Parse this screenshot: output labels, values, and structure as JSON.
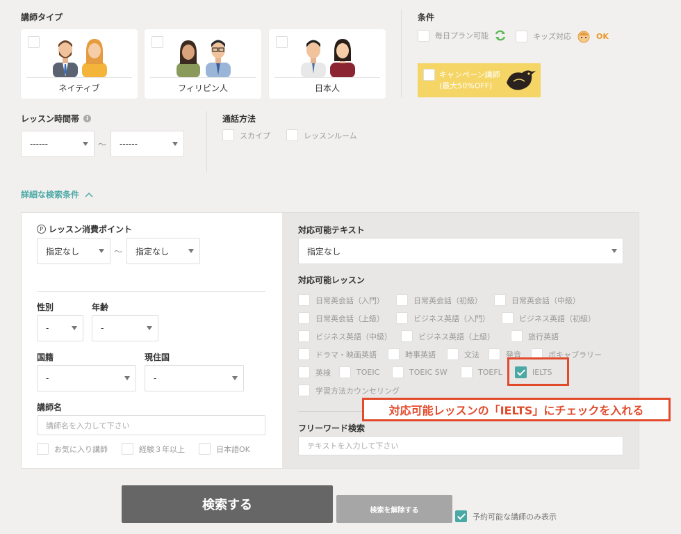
{
  "teacher_type": {
    "title": "講師タイプ",
    "cards": [
      {
        "label": "ネイティブ"
      },
      {
        "label": "フィリピン人"
      },
      {
        "label": "日本人"
      }
    ]
  },
  "conditions": {
    "title": "条件",
    "daily_plan": "毎日プラン可能",
    "kids": "キッズ対応",
    "kids_badge": "OK",
    "campaign_line1": "キャンペーン講師",
    "campaign_line2": "(最大50%OFF)"
  },
  "lesson_time": {
    "title": "レッスン時間帯",
    "from": "------",
    "to": "------",
    "tilde": "〜"
  },
  "call_method": {
    "title": "通話方法",
    "skype": "スカイプ",
    "room": "レッスンルーム"
  },
  "advanced": {
    "toggle_label": "詳細な検索条件"
  },
  "points": {
    "title": "レッスン消費ポイント",
    "p_icon": "P",
    "from": "指定なし",
    "to": "指定なし",
    "tilde": "〜"
  },
  "gender": {
    "title": "性別",
    "value": "-"
  },
  "age": {
    "title": "年齢",
    "value": "-"
  },
  "nationality": {
    "title": "国籍",
    "value": "-"
  },
  "residence": {
    "title": "現住国",
    "value": "-"
  },
  "teacher_name": {
    "title": "講師名",
    "placeholder": "講師名を入力して下さい"
  },
  "extra": {
    "favorites": "お気に入り講師",
    "experience": "経験３年以上",
    "japanese_ok": "日本語OK"
  },
  "textbook": {
    "title": "対応可能テキスト",
    "value": "指定なし"
  },
  "lessons": {
    "title": "対応可能レッスン",
    "items": [
      {
        "label": "日常英会話（入門）",
        "checked": false
      },
      {
        "label": "日常英会話（初級）",
        "checked": false
      },
      {
        "label": "日常英会話（中級）",
        "checked": false
      },
      {
        "label": "日常英会話（上級）",
        "checked": false
      },
      {
        "label": "ビジネス英語（入門）",
        "checked": false
      },
      {
        "label": "ビジネス英語（初級）",
        "checked": false
      },
      {
        "label": "ビジネス英語（中級）",
        "checked": false
      },
      {
        "label": "ビジネス英語（上級）",
        "checked": false
      },
      {
        "label": "旅行英語",
        "checked": false
      },
      {
        "label": "ドラマ・映画英語",
        "checked": false
      },
      {
        "label": "時事英語",
        "checked": false
      },
      {
        "label": "文法",
        "checked": false
      },
      {
        "label": "発音",
        "checked": false
      },
      {
        "label": "ボキャブラリー",
        "checked": false
      },
      {
        "label": "英検",
        "checked": false
      },
      {
        "label": "TOEIC",
        "checked": false
      },
      {
        "label": "TOEIC SW",
        "checked": false
      },
      {
        "label": "TOEFL",
        "checked": false
      },
      {
        "label": "IELTS",
        "checked": true
      },
      {
        "label": "学習方法カウンセリング",
        "checked": false
      }
    ]
  },
  "annotation": {
    "text": "対応可能レッスンの「IELTS」にチェックを入れる"
  },
  "free_word": {
    "title": "フリーワード検索",
    "placeholder": "テキストを入力して下さい"
  },
  "buttons": {
    "search": "検索する",
    "clear": "検索を解除する",
    "available_only": "予約可能な講師のみ表示"
  },
  "colors": {
    "accent": "#4aa9a4",
    "campaign_bg": "#f5d565",
    "annotation": "#e24a2b",
    "search_btn": "#666666",
    "clear_btn": "#a6a6a6"
  }
}
